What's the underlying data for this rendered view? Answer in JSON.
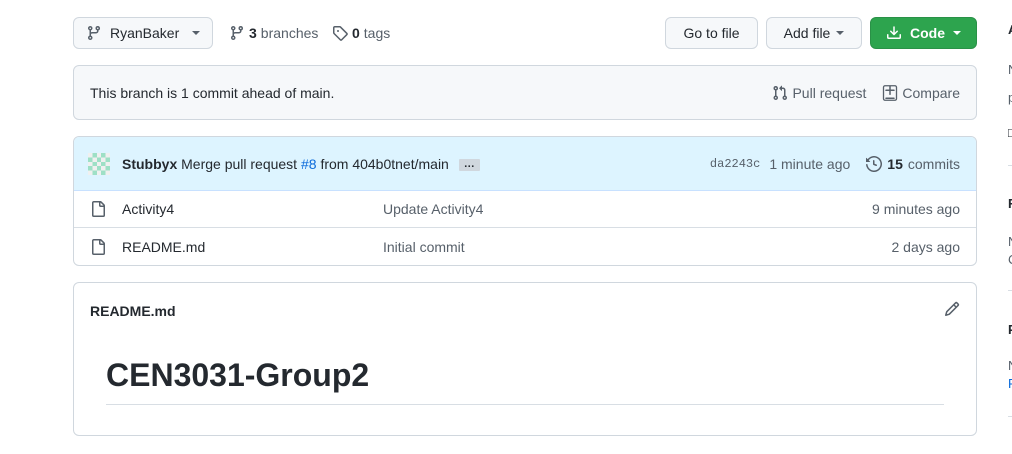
{
  "toolbar": {
    "branch": "RyanBaker",
    "branches_count": "3",
    "branches_label": "branches",
    "tags_count": "0",
    "tags_label": "tags",
    "goto_file": "Go to file",
    "add_file": "Add file",
    "code": "Code"
  },
  "ahead": {
    "message": "This branch is 1 commit ahead of main.",
    "pull_request": "Pull request",
    "compare": "Compare"
  },
  "latest_commit": {
    "author": "Stubbyx",
    "message_prefix": "Merge pull request",
    "pr_ref": "#8",
    "message_suffix": "from 404b0tnet/main",
    "ellipsis": "…",
    "sha": "da2243c",
    "time": "1 minute ago",
    "commits_count": "15",
    "commits_label": "commits"
  },
  "files": [
    {
      "name": "Activity4",
      "commit": "Update Activity4",
      "age": "9 minutes ago"
    },
    {
      "name": "README.md",
      "commit": "Initial commit",
      "age": "2 days ago"
    }
  ],
  "readme": {
    "title": "README.md",
    "heading": "CEN3031-Group2"
  },
  "colors": {
    "primary_button": "#2da44e",
    "link": "#0969da",
    "commit_bar": "#ddf4ff",
    "border": "#d0d7de"
  },
  "icons": [
    "branch-icon",
    "tag-icon",
    "download-icon",
    "pull-request-icon",
    "compare-icon",
    "history-icon",
    "file-icon",
    "pencil-icon",
    "avatar-identicon"
  ]
}
